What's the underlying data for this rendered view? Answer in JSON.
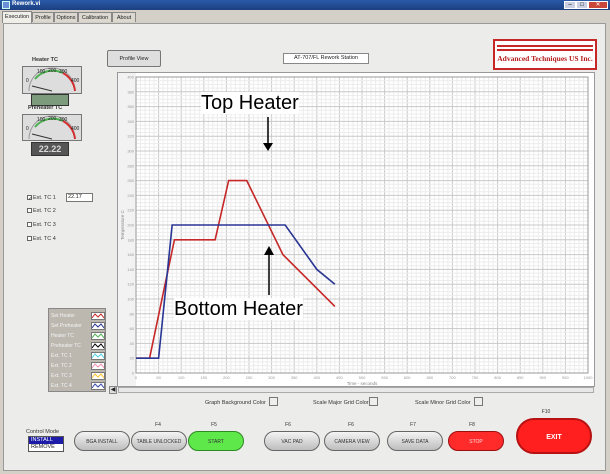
{
  "window": {
    "title": "Rework.vi"
  },
  "tabs": [
    "Execution",
    "Profile",
    "Options",
    "Calibration",
    "About"
  ],
  "gauges": {
    "heater": {
      "title": "Heater TC",
      "ticks": [
        "100",
        "200",
        "300",
        "0",
        "400"
      ],
      "readout": ""
    },
    "preheater": {
      "title": "Preheater TC",
      "ticks": [
        "100",
        "200",
        "300",
        "0",
        "400"
      ],
      "readout": "22.22"
    }
  },
  "profile_button": "Profile View",
  "station_label": "AT-707/FL Rework Station",
  "logo_text": "Advanced Techniques US Inc.",
  "ext_tc": [
    {
      "label": "Ext. TC 1",
      "checked": true,
      "value": "22.17"
    },
    {
      "label": "Ext. TC 2",
      "checked": false
    },
    {
      "label": "Ext. TC 3",
      "checked": false
    },
    {
      "label": "Ext. TC 4",
      "checked": false
    }
  ],
  "annotations": {
    "top": "Top Heater",
    "bottom": "Bottom Heater"
  },
  "legend": [
    "Set Heater",
    "Set Preheater",
    "Heater TC",
    "Preheater TC",
    "Ext. TC 1",
    "Ext. TC 2",
    "Ext. TC 3",
    "Ext. TC 4"
  ],
  "colors": {
    "top_heater": "#c62828",
    "bottom_heater": "#283593",
    "legend_swatches": [
      "#c62828",
      "#283593",
      "#4caf50",
      "#000000",
      "#4dd0e1",
      "#f48fb1",
      "#fbc02d",
      "#3949ab"
    ],
    "start_button": "#5ee84a",
    "stop_button": "#ff2a2a",
    "exit_button": "#ff1f1f"
  },
  "color_settings": [
    "Graph Background Color",
    "Scale Major Grid Color",
    "Scale Minor Grid Color"
  ],
  "control_mode": {
    "label": "Control Mode",
    "options": [
      "INSTALL",
      "REMOVE"
    ],
    "selected": "INSTALL"
  },
  "function_keys": [
    {
      "key": "",
      "label": "BGA INSTALL"
    },
    {
      "key": "F4",
      "label": "TABLE UNLOCKED"
    },
    {
      "key": "F5",
      "label": "START"
    },
    {
      "key": "F6",
      "label": "VAC PAD"
    },
    {
      "key": "F6",
      "label": "CAMERA VIEW"
    },
    {
      "key": "F7",
      "label": "SAVE DATA"
    },
    {
      "key": "F8",
      "label": "STOP"
    },
    {
      "key": "F10",
      "label": "EXIT"
    }
  ],
  "chart_data": {
    "type": "line",
    "title": "",
    "xlabel": "Time - seconds",
    "ylabel": "Temperature C",
    "xlim": [
      0,
      1000
    ],
    "ylim": [
      0,
      400
    ],
    "grid": true,
    "series": [
      {
        "name": "Top Heater",
        "x": [
          0,
          30,
          85,
          175,
          205,
          245,
          325,
          440
        ],
        "y": [
          20,
          20,
          180,
          180,
          260,
          260,
          160,
          90
        ]
      },
      {
        "name": "Bottom Heater",
        "x": [
          0,
          50,
          80,
          330,
          400,
          440
        ],
        "y": [
          20,
          20,
          200,
          200,
          140,
          120
        ]
      }
    ]
  }
}
